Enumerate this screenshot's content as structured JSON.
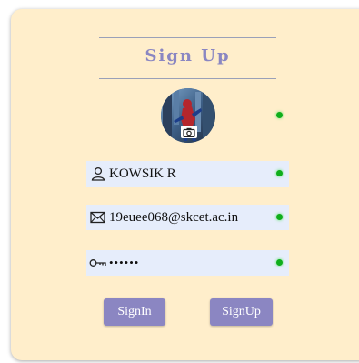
{
  "header": {
    "title": "Sign Up"
  },
  "profile": {
    "avatar_icon": "profile-photo",
    "upload_icon": "camera-icon",
    "status_color": "#0fae1b"
  },
  "fields": {
    "name": {
      "icon": "user-icon",
      "value": "KOWSIK R"
    },
    "email": {
      "icon": "mail-icon",
      "value": "19euee068@skcet.ac.in"
    },
    "password": {
      "icon": "key-icon",
      "value": "••••••"
    }
  },
  "buttons": {
    "signin_label": "SignIn",
    "signup_label": "SignUp"
  },
  "colors": {
    "card_bg": "#ffeecb",
    "accent": "#8b86c2",
    "field_bg": "#e6edfb"
  }
}
